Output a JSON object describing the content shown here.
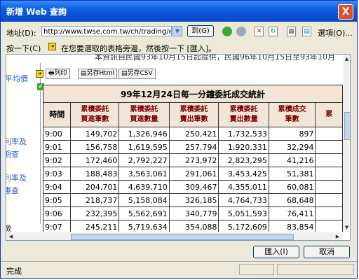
{
  "window": {
    "title": "新增 Web 查詢",
    "close_label": "X"
  },
  "address_bar": {
    "label": "地址(D):",
    "url": "http://www.twse.com.tw/ch/trading/exchange",
    "go_label": "到(G)",
    "options_label": "選項(O)..."
  },
  "hint": {
    "click_next": "按一下(C)",
    "text": "在您要選取的表格旁邊，然後按一下 [匯入]。"
  },
  "background": {
    "notice": "本資訊自民國93年10月15日起提供，民國96年10月15日至93年10月",
    "left_labels": [
      "平均價",
      "利率及",
      "期查",
      "利率及",
      "惠查",
      "緻"
    ]
  },
  "page_buttons": {
    "print": "列印",
    "save_html": "另存Html",
    "save_csv": "另存CSV"
  },
  "table": {
    "caption": "99年12月24日每一分鐘委託成交統計",
    "headers": [
      "時間",
      "累積委託\n買進筆數",
      "累積委託\n買進數量",
      "累積委託\n賣出筆數",
      "累積委託\n賣出數量",
      "累積成交\n筆數",
      "累"
    ],
    "rows": [
      [
        "9:00",
        "149,702",
        "1,326,946",
        "250,421",
        "1,732,533",
        "897"
      ],
      [
        "9:01",
        "156,758",
        "1,619,595",
        "257,794",
        "1,920,331",
        "32,294"
      ],
      [
        "9:02",
        "172,460",
        "2,792,227",
        "273,972",
        "2,823,295",
        "41,216"
      ],
      [
        "9:03",
        "188,483",
        "3,563,061",
        "291,061",
        "3,453,425",
        "51,381"
      ],
      [
        "9:04",
        "204,701",
        "4,639,710",
        "309,467",
        "4,355,011",
        "60,081"
      ],
      [
        "9:05",
        "218,737",
        "5,158,084",
        "326,185",
        "4,764,733",
        "68,648"
      ],
      [
        "9:06",
        "232,395",
        "5,562,691",
        "340,779",
        "5,051,593",
        "76,411"
      ],
      [
        "9:07",
        "245,211",
        "5,719,634",
        "354,088",
        "5,172,609",
        "83,854"
      ]
    ]
  },
  "buttons": {
    "import": "匯入(I)",
    "cancel": "取消"
  },
  "status": {
    "text": "完成"
  }
}
